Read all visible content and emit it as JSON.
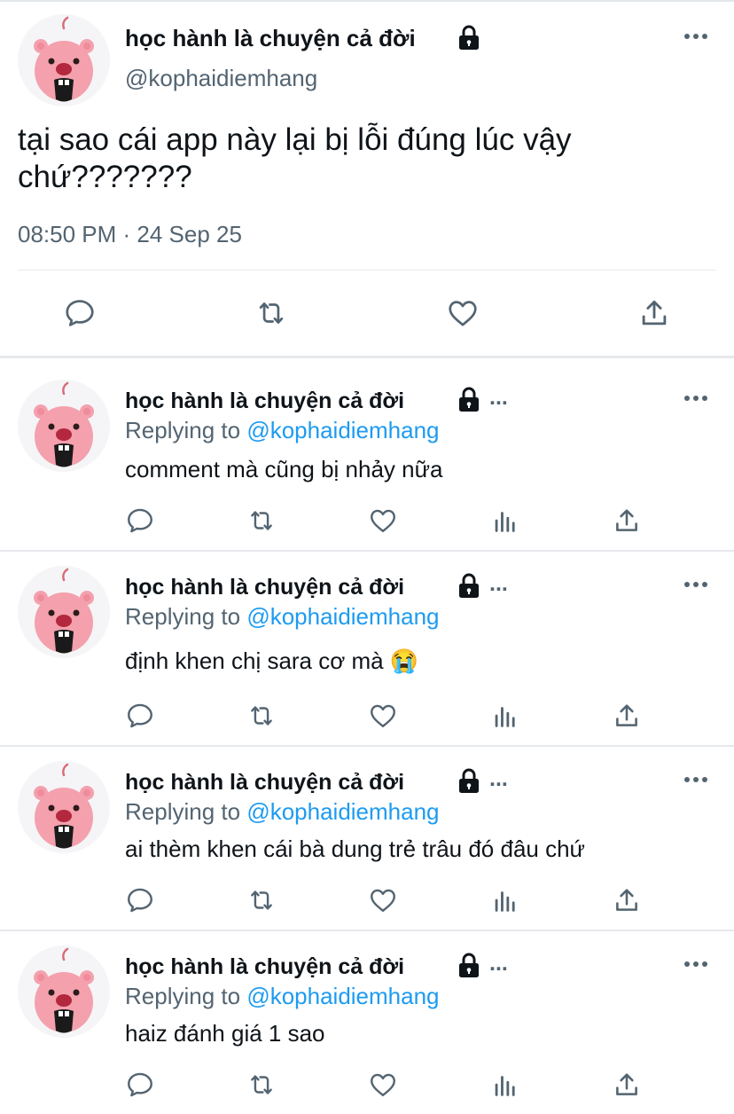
{
  "tweet": {
    "author_name": "học hành là chuyện cả đời",
    "handle": "@kophaidiemhang",
    "text": "tại sao cái app này lại bị lỗi đúng lúc vậy chứ???????",
    "timestamp": "08:50 PM · 24 Sep 25",
    "actions": [
      "reply-icon",
      "retweet-icon",
      "like-icon",
      "share-icon"
    ]
  },
  "replies": [
    {
      "author_name": "học hành là chuyện cả đời",
      "ellipsis": "...",
      "replying_prefix": "Replying to",
      "replying_handle": "@kophaidiemhang",
      "text": "comment mà cũng bị nhảy nữa"
    },
    {
      "author_name": "học hành là chuyện cả đời",
      "ellipsis": "...",
      "replying_prefix": "Replying to",
      "replying_handle": "@kophaidiemhang",
      "text": "định khen chị sara cơ mà 😭"
    },
    {
      "author_name": "học hành là chuyện cả đời",
      "ellipsis": "...",
      "replying_prefix": "Replying to",
      "replying_handle": "@kophaidiemhang",
      "text": "ai thèm khen cái bà dung trẻ trâu đó đâu chứ"
    },
    {
      "author_name": "học hành là chuyện cả đời",
      "ellipsis": "...",
      "replying_prefix": "Replying to",
      "replying_handle": "@kophaidiemhang",
      "text": "haiz đánh giá 1 sao"
    }
  ],
  "reply_actions": [
    "reply-icon",
    "retweet-icon",
    "like-icon",
    "analytics-icon",
    "share-icon"
  ],
  "colors": {
    "text": "#0f1419",
    "secondary": "#536471",
    "link": "#1d9bf0",
    "avatar": "#f4a0ad",
    "divider": "#e6e9ec"
  }
}
